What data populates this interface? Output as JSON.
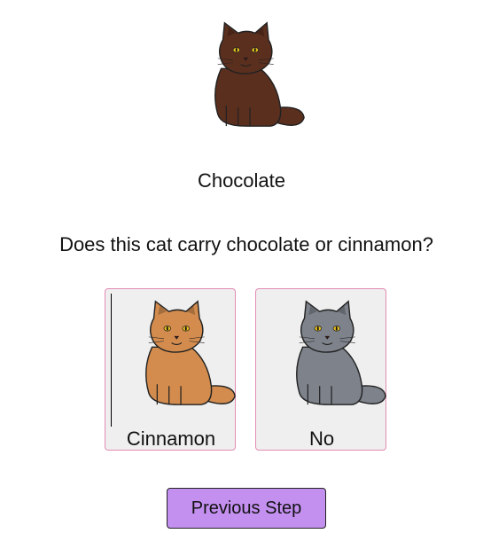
{
  "breed": {
    "name": "Chocolate",
    "icon": "cat-icon",
    "color": "#5b2f1e"
  },
  "question": "Does this cat carry chocolate or cinnamon?",
  "options": [
    {
      "label": "Cinnamon",
      "icon": "cat-icon",
      "color": "#d38c4e"
    },
    {
      "label": "No",
      "icon": "cat-icon",
      "color": "#7d828b"
    }
  ],
  "navigation": {
    "previous_label": "Previous Step"
  },
  "colors": {
    "card_border": "#e48ab4",
    "card_background": "#efefef",
    "button_background": "#c390ef"
  }
}
